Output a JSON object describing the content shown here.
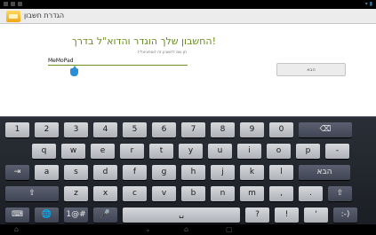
{
  "status_bar": {
    "time": ""
  },
  "title_bar": {
    "title": "הגדרת חשבון"
  },
  "content": {
    "heading": "החשבון שלך הוגדר והדוא\"ל בדרך!",
    "field_label": "תן שם לחשבון זה (אופציונלי)",
    "username_value": "MeMoPad",
    "next_label": "הבא"
  },
  "keyboard": {
    "rows": [
      [
        "1",
        "2",
        "3",
        "4",
        "5",
        "6",
        "7",
        "8",
        "9",
        "0",
        "⌫"
      ],
      [
        "q",
        "w",
        "e",
        "r",
        "t",
        "y",
        "u",
        "i",
        "o",
        "p",
        "-"
      ],
      [
        "⇥",
        "a",
        "s",
        "d",
        "f",
        "g",
        "h",
        "j",
        "k",
        "l",
        "הבא"
      ],
      [
        "⇧",
        "z",
        "x",
        "c",
        "v",
        "b",
        "n",
        "m",
        ",",
        ".",
        "⇧"
      ],
      [
        "⌨",
        "🌐",
        "1@#",
        "🎤",
        "␣",
        "?",
        "!",
        "'",
        ":-)"
      ]
    ],
    "dark_keys": [
      "⌫",
      "⇥",
      "הבא",
      "⇧",
      "⌨",
      "🌐",
      "1@#",
      "🎤",
      ":-)"
    ]
  },
  "nav_bar": {
    "icons": [
      "home-small-icon",
      "back-icon",
      "home-icon",
      "recents-icon"
    ]
  },
  "colors": {
    "accent": "#6a8d1f",
    "cursor": "#2b8fd8",
    "keyboard_bg": "#1f2329"
  }
}
